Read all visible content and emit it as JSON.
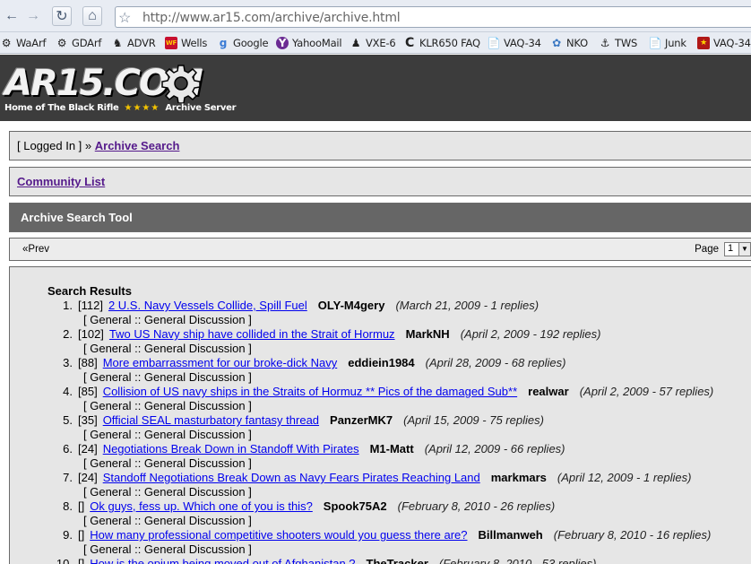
{
  "browser": {
    "url_prefix": "http://www.ar15.com",
    "url_path": "/archive/archive.html",
    "bookmarks": [
      {
        "label": "WaArf",
        "icon": "gear-icon"
      },
      {
        "label": "GDArf",
        "icon": "gear-icon"
      },
      {
        "label": "ADVR",
        "icon": "rider-icon"
      },
      {
        "label": "Wells",
        "icon": "wells-fargo-icon"
      },
      {
        "label": "Google",
        "icon": "google-icon"
      },
      {
        "label": "YahooMail",
        "icon": "yahoo-icon"
      },
      {
        "label": "VXE-6",
        "icon": "penguin-icon"
      },
      {
        "label": "KLR650 FAQ",
        "icon": "c-logo-icon"
      },
      {
        "label": "VAQ-34",
        "icon": "page-icon"
      },
      {
        "label": "NKO",
        "icon": "nko-icon"
      },
      {
        "label": "TWS",
        "icon": "ship-icon"
      },
      {
        "label": "Junk",
        "icon": "page-icon"
      },
      {
        "label": "VAQ-34",
        "icon": "squadron-icon"
      }
    ]
  },
  "site": {
    "logo": "AR15.COM",
    "tagline_left": "Home of The Black Rifle",
    "stars": "★★★★",
    "tagline_right": "Archive Server"
  },
  "breadcrumb": {
    "prefix": "[ Logged In ] »",
    "link": "Archive Search"
  },
  "community_link": "Community List",
  "tool_title": "Archive Search Tool",
  "pager": {
    "prev": "«Prev",
    "page_label": "Page",
    "page_value": "1"
  },
  "results": {
    "title": "Search Results",
    "items": [
      {
        "num": "1.",
        "count": "[112]",
        "title": "2 U.S. Navy Vessels Collide, Spill Fuel",
        "user": "OLY-M4gery",
        "meta": "(March 21, 2009  -  1 replies)",
        "forum": "[ General :: General Discussion ]"
      },
      {
        "num": "2.",
        "count": "[102]",
        "title": "Two US Navy ship have collided in the Strait of Hormuz",
        "user": "MarkNH",
        "meta": "(April 2, 2009  -  192 replies)",
        "forum": "[ General :: General Discussion ]"
      },
      {
        "num": "3.",
        "count": "[88]",
        "title": "More embarrassment for our broke-dick Navy",
        "user": "eddiein1984",
        "meta": "(April 28, 2009  -  68 replies)",
        "forum": "[ General :: General Discussion ]"
      },
      {
        "num": "4.",
        "count": "[85]",
        "title": "Collision of US navy ships in the Straits of Hormuz ** Pics of the damaged Sub**",
        "user": "realwar",
        "meta": "(April 2, 2009  -  57 replies)",
        "forum": "[ General :: General Discussion ]"
      },
      {
        "num": "5.",
        "count": "[35]",
        "title": "Official SEAL masturbatory fantasy thread",
        "user": "PanzerMK7",
        "meta": "(April 15, 2009  -  75 replies)",
        "forum": "[ General :: General Discussion ]"
      },
      {
        "num": "6.",
        "count": "[24]",
        "title": "Negotiations Break Down in Standoff With Pirates",
        "user": "M1-Matt",
        "meta": "(April 12, 2009  -  66 replies)",
        "forum": "[ General :: General Discussion ]"
      },
      {
        "num": "7.",
        "count": "[24]",
        "title": "Standoff Negotiations Break Down as Navy Fears Pirates Reaching Land",
        "user": "markmars",
        "meta": "(April 12, 2009  -  1 replies)",
        "forum": "[ General :: General Discussion ]"
      },
      {
        "num": "8.",
        "count": "[]",
        "title": "Ok guys, fess up. Which one of you is this?",
        "user": "Spook75A2",
        "meta": "(February 8, 2010  -  26 replies)",
        "forum": "[ General :: General Discussion ]"
      },
      {
        "num": "9.",
        "count": "[]",
        "title": "How many professional competitive shooters would you guess there are?",
        "user": "Billmanweh",
        "meta": "(February 8, 2010  -  16 replies)",
        "forum": "[ General :: General Discussion ]"
      },
      {
        "num": "10.",
        "count": "[]",
        "title": "How is the opium being moved out of Afghanistan ?",
        "user": "TheTracker",
        "meta": "(February 8, 2010  -  53 replies)",
        "forum": ""
      }
    ]
  }
}
